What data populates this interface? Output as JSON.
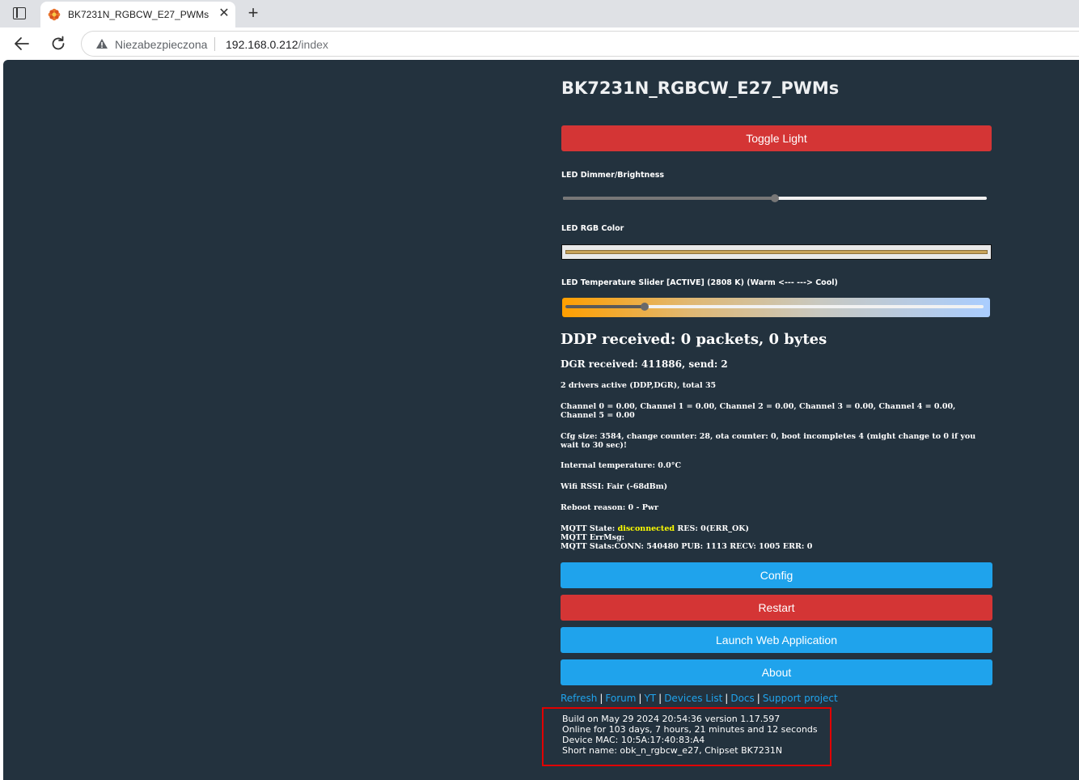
{
  "browser": {
    "tab_title": "BK7231N_RGBCW_E27_PWMs",
    "new_tab_symbol": "+",
    "close_symbol": "✕",
    "security_label": "Niezabezpieczona",
    "url_host": "192.168.0.212",
    "url_path": "/index"
  },
  "device": {
    "title": "BK7231N_RGBCW_E27_PWMs"
  },
  "controls": {
    "toggle_label": "Toggle Light",
    "dimmer_label": "LED Dimmer/Brightness",
    "dimmer_level_percent": 50,
    "rgb_label": "LED RGB Color",
    "rgb_color": "#c9a45a",
    "temperature_label": "LED Temperature Slider [ACTIVE] (2808 K) (Warm <--- ---> Cool)",
    "temperature_level_percent": 19
  },
  "status": {
    "ddp": "DDP received: 0 packets, 0 bytes",
    "dgr": "DGR received: 411886, send: 2",
    "drivers": "2 drivers active (DDP,DGR), total 35",
    "channels": "Channel 0 = 0.00, Channel 1 = 0.00, Channel 2 = 0.00, Channel 3 = 0.00, Channel 4 = 0.00, Channel 5 = 0.00",
    "cfg": "Cfg size: 3584, change counter: 28, ota counter: 0, boot incompletes 4 (might change to 0 if you wait to 30 sec)!",
    "temperature": "Internal temperature: 0.0°C",
    "wifi": "Wifi RSSI: Fair (-68dBm)",
    "reboot": "Reboot reason: 0 - Pwr",
    "mqtt_state_prefix": "MQTT State: ",
    "mqtt_state_value": "disconnected",
    "mqtt_state_suffix": " RES: 0(ERR_OK)",
    "mqtt_errmsg": "MQTT ErrMsg:",
    "mqtt_stats": "MQTT Stats:CONN: 540480 PUB: 1113 RECV: 1005 ERR: 0"
  },
  "buttons": {
    "config": "Config",
    "restart": "Restart",
    "launch": "Launch Web Application",
    "about": "About"
  },
  "links": {
    "refresh": "Refresh",
    "forum": "Forum",
    "yt": "YT",
    "devices": "Devices List",
    "docs": "Docs",
    "support": "Support project",
    "separator": "|"
  },
  "build": {
    "line1": "Build on May 29 2024 20:54:36 version 1.17.597",
    "line2": "Online for 103 days, 7 hours, 21 minutes and 12 seconds",
    "line3": "Device MAC: 10:5A:17:40:83:A4",
    "line4": "Short name: obk_n_rgbcw_e27, Chipset BK7231N"
  },
  "colors": {
    "page_bg": "#23323e",
    "button_blue": "#1fa3ec",
    "button_red": "#d43535",
    "highlight_box": "#e00000",
    "mqtt_disconnected": "#ffff00"
  }
}
